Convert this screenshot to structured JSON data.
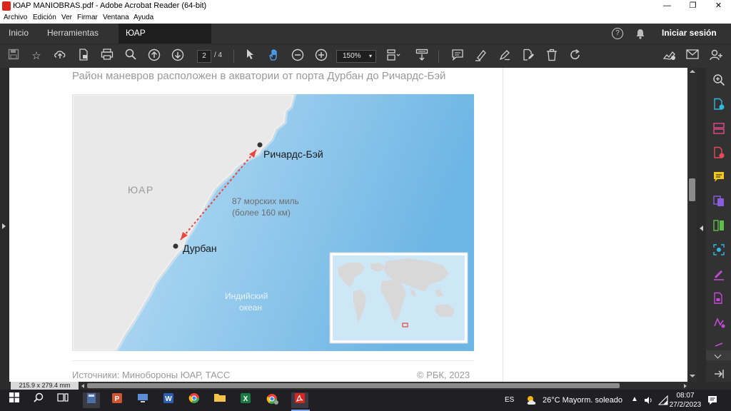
{
  "window": {
    "title": "ЮАР MANIOBRAS.pdf - Adobe Acrobat Reader (64-bit)",
    "min_glyph": "—",
    "max_glyph": "❐",
    "close_glyph": "✕"
  },
  "menu": [
    "Archivo",
    "Edición",
    "Ver",
    "Firmar",
    "Ventana",
    "Ayuda"
  ],
  "tabs": {
    "home": "Inicio",
    "tools": "Herramientas",
    "doc": "ЮАР MANIOBRAS...",
    "doc_close": "✕",
    "help_icon": "?",
    "signin": "Iniciar sesión"
  },
  "toolbar": {
    "page_current": "2",
    "page_sep": "/ 4",
    "zoom": "150%"
  },
  "document": {
    "heading": "Район маневров расположен в акватории от порта Дурбан до Ричардс-Бэй",
    "map": {
      "country_label": "ЮАР",
      "city_north": "Ричардс-Бэй",
      "city_south": "Дурбан",
      "distance_line1": "87 морских миль",
      "distance_line2": "(более 160 км)",
      "ocean_line1": "Индийский",
      "ocean_line2": "океан",
      "land_color": "#e9e9e9",
      "sea_color": "#7ec0e6",
      "route_color": "#e8463e"
    },
    "sources": "Источники: Минобороны ЮАР, ТАСС",
    "copyright": "© РБК, 2023"
  },
  "status": {
    "page_size": "215.9 x 279.4 mm"
  },
  "taskbar": {
    "lang": "ES",
    "weather": "26°C  Mayorm. soleado",
    "time": "08:07",
    "date": "27/2/2023"
  }
}
